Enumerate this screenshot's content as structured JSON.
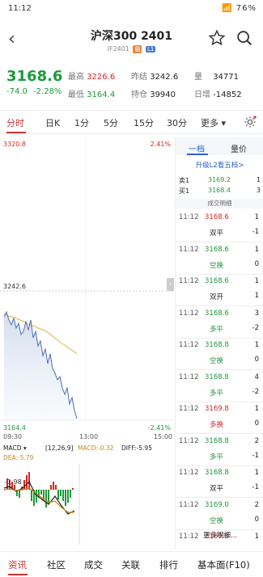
{
  "status": {
    "time": "11:12",
    "battery": "76%"
  },
  "header": {
    "title": "沪深300 2401",
    "subtitle": "IF2401",
    "tag1": "融",
    "tag2": "L1"
  },
  "quote": {
    "price": "3168.6",
    "change": "-74.0",
    "pct": "-2.28%",
    "items": [
      {
        "label": "最高",
        "value": "3226.6",
        "color": "red"
      },
      {
        "label": "最低",
        "value": "3164.4",
        "color": "green"
      },
      {
        "label": "昨结",
        "value": "3242.6",
        "color": "normal"
      },
      {
        "label": "持仓",
        "value": "39940",
        "color": "normal"
      },
      {
        "label": "量",
        "value": "34771",
        "color": "normal"
      },
      {
        "label": "日增",
        "value": "-14852",
        "color": "normal"
      }
    ]
  },
  "tabs": [
    "分时",
    "日K",
    "1分",
    "5分",
    "15分",
    "30分",
    "更多"
  ],
  "active_tab": "分时",
  "chart": {
    "top_price": "3320.8",
    "top_pct": "2.41%",
    "mid_price": "3242.6",
    "low_price": "3164.4",
    "low_pct": "-2.41%",
    "time_start": "09:30",
    "time_mid": "13:00",
    "time_end": "15:00"
  },
  "macd": {
    "label": "MACD",
    "params": "[12,26,9]",
    "macd": "MACD:-0.32",
    "diff": "DIFF:-5.95",
    "dea": "DEA:-5.79",
    "axis": "-1.98"
  },
  "right_panel": {
    "tab1": "一档",
    "tab2": "量价",
    "upgrade": "升级L2看五档>",
    "ask_label": "卖1",
    "ask_price": "3169.2",
    "ask_qty": "1",
    "bid_label": "买1",
    "bid_price": "3168.4",
    "bid_qty": "3",
    "trades_title": "成交明细",
    "trades": [
      {
        "time": "11:12",
        "price": "3168.6",
        "vol": "1",
        "type": "双平",
        "oi": "-1",
        "pc": "red",
        "tc": "normal"
      },
      {
        "time": "11:12",
        "price": "3168.6",
        "vol": "1",
        "type": "空换",
        "oi": "0",
        "pc": "green",
        "tc": "green"
      },
      {
        "time": "11:12",
        "price": "3168.6",
        "vol": "1",
        "type": "双开",
        "oi": "1",
        "pc": "green",
        "tc": "normal"
      },
      {
        "time": "11:12",
        "price": "3168.6",
        "vol": "3",
        "type": "多平",
        "oi": "-2",
        "pc": "green",
        "tc": "green"
      },
      {
        "time": "11:12",
        "price": "3168.8",
        "vol": "1",
        "type": "空换",
        "oi": "0",
        "pc": "green",
        "tc": "green"
      },
      {
        "time": "11:12",
        "price": "3168.8",
        "vol": "4",
        "type": "多平",
        "oi": "-2",
        "pc": "green",
        "tc": "green"
      },
      {
        "time": "11:12",
        "price": "3169.8",
        "vol": "1",
        "type": "多换",
        "oi": "0",
        "pc": "red",
        "tc": "red"
      },
      {
        "time": "11:12",
        "price": "3168.8",
        "vol": "2",
        "type": "多平",
        "oi": "-1",
        "pc": "green",
        "tc": "green"
      },
      {
        "time": "11:12",
        "price": "3168.8",
        "vol": "1",
        "type": "双平",
        "oi": "-1",
        "pc": "green",
        "tc": "normal"
      },
      {
        "time": "11:12",
        "price": "3169.0",
        "vol": "2",
        "type": "空换",
        "oi": "0",
        "pc": "green",
        "tc": "green"
      },
      {
        "time": "11:12",
        "price": "3169.8",
        "vol": "1",
        "type": "",
        "oi": "",
        "pc": "red",
        "tc": "normal"
      }
    ],
    "more": "更多明细..."
  },
  "bottom_nav": [
    "资讯",
    "社区",
    "成交",
    "关联",
    "排行",
    "基本面(F10)"
  ],
  "colors": {
    "up": "#d22",
    "down": "#1b9a3a",
    "accent": "#c33"
  }
}
